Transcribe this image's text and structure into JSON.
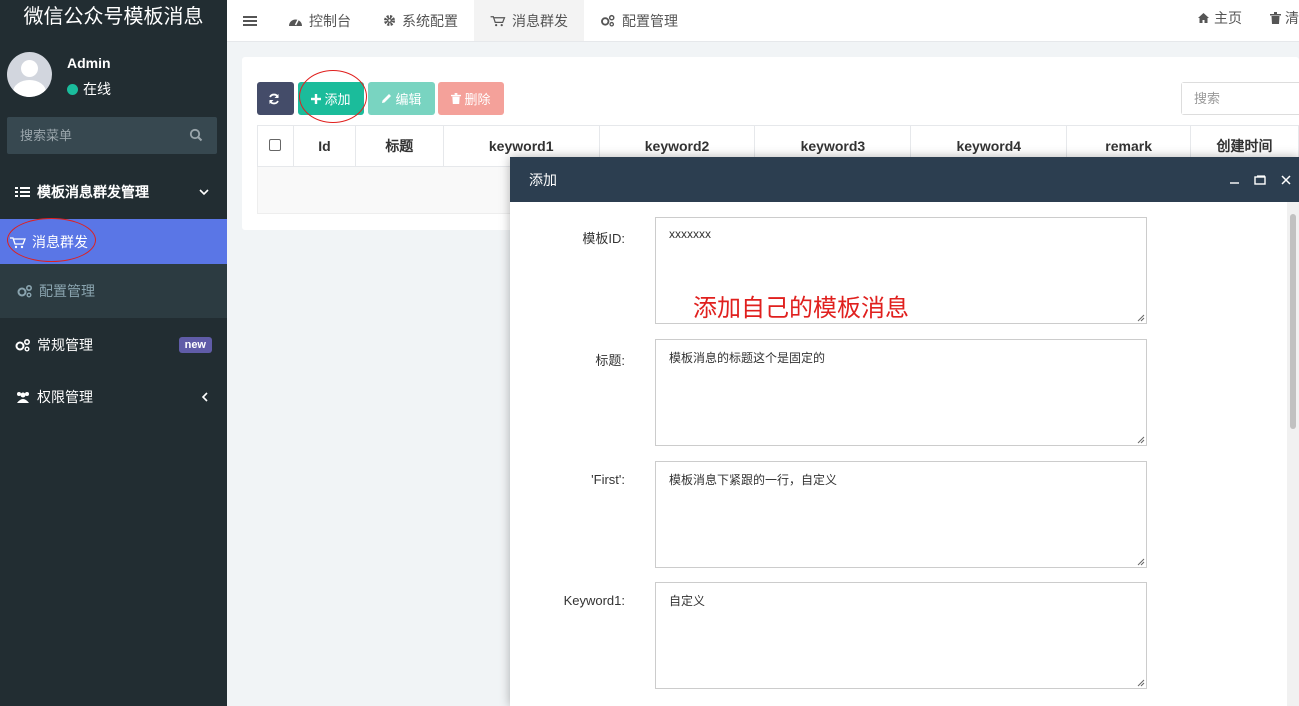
{
  "sidebar": {
    "logo": "微信公众号模板消息",
    "user": {
      "name": "Admin",
      "status": "在线"
    },
    "search_placeholder": "搜索菜单",
    "menu": {
      "group_title": "模板消息群发管理",
      "active_item": "消息群发",
      "sub_item": "配置管理",
      "general": "常规管理",
      "general_badge": "new",
      "permission": "权限管理"
    }
  },
  "topnav": {
    "tabs": [
      {
        "label": "控制台",
        "icon": "dashboard-icon"
      },
      {
        "label": "系统配置",
        "icon": "gear-icon"
      },
      {
        "label": "消息群发",
        "icon": "cart-icon"
      },
      {
        "label": "配置管理",
        "icon": "gears-icon"
      }
    ],
    "home": "主页",
    "clear": "清"
  },
  "toolbar": {
    "add": "添加",
    "edit": "编辑",
    "delete": "删除",
    "search_placeholder": "搜索"
  },
  "table": {
    "columns": [
      "Id",
      "标题",
      "keyword1",
      "keyword2",
      "keyword3",
      "keyword4",
      "remark",
      "创建时间"
    ]
  },
  "modal": {
    "title": "添加",
    "fields": [
      {
        "label": "模板ID:",
        "value": "xxxxxxx"
      },
      {
        "label": "标题:",
        "value": "模板消息的标题这个是固定的"
      },
      {
        "label": "'First':",
        "value": "模板消息下紧跟的一行，自定义"
      },
      {
        "label": "Keyword1:",
        "value": "自定义"
      }
    ],
    "annotation": "添加自己的模板消息"
  },
  "colors": {
    "sidebar_bg": "#222d32",
    "active_menu": "#5a76e6",
    "add_button": "#1bbc9b",
    "modal_header": "#2c3e50",
    "annotation": "#e0201e"
  }
}
